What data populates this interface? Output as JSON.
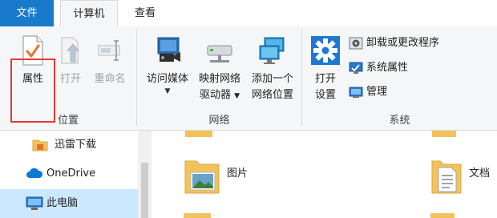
{
  "tabs": {
    "file": "文件",
    "computer": "计算机",
    "view": "查看"
  },
  "ribbon": {
    "location": {
      "group_label": "位置",
      "properties": "属性",
      "open": "打开",
      "rename": "重命名"
    },
    "network": {
      "group_label": "网络",
      "access_media": "访问媒体",
      "map_drive_line1": "映射网络",
      "map_drive_line2": "驱动器",
      "add_location_line1": "添加一个",
      "add_location_line2": "网络位置"
    },
    "system": {
      "group_label": "系统",
      "open_settings_line1": "打开",
      "open_settings_line2": "设置",
      "uninstall": "卸载或更改程序",
      "system_properties": "系统属性",
      "manage": "管理"
    }
  },
  "nav": {
    "items": [
      {
        "label": "迅雷下载",
        "icon": "folder-icon"
      },
      {
        "label": "OneDrive",
        "icon": "cloud-icon"
      },
      {
        "label": "此电脑",
        "icon": "computer-icon"
      }
    ]
  },
  "content": {
    "items": [
      {
        "label": "图片",
        "icon": "pictures-folder-icon"
      },
      {
        "label": "文档",
        "icon": "documents-folder-icon"
      }
    ]
  },
  "colors": {
    "accent": "#1979ca",
    "highlight_box": "#e53935",
    "selected": "#cce8ff"
  }
}
